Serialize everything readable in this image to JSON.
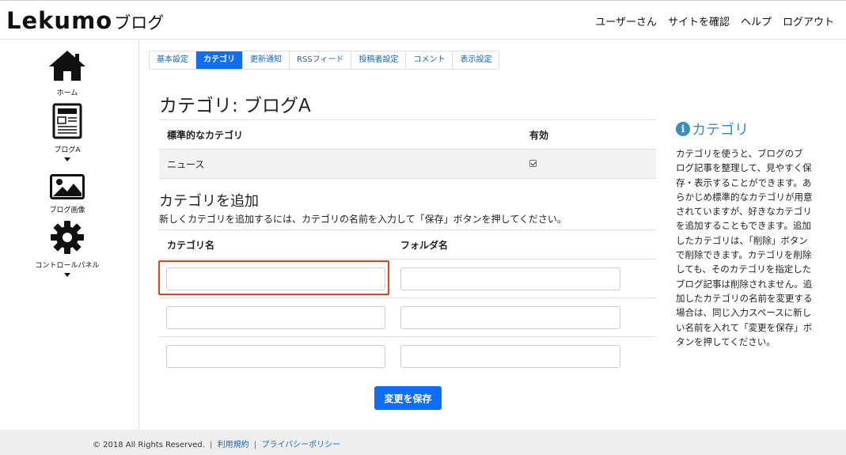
{
  "header": {
    "logo_main": "Lekumo",
    "logo_sub": "ブログ",
    "nav": [
      "ユーザーさん",
      "サイトを確認",
      "ヘルプ",
      "ログアウト"
    ]
  },
  "sidebar": {
    "items": [
      {
        "label": "ホーム",
        "icon": "home-icon"
      },
      {
        "label": "ブログA",
        "icon": "blog-icon"
      },
      {
        "label": "ブログ画像",
        "icon": "image-icon"
      },
      {
        "label": "コントロールパネル",
        "icon": "gear-icon"
      }
    ]
  },
  "tabs": [
    "基本設定",
    "カテゴリ",
    "更新通知",
    "RSSフィード",
    "投稿者設定",
    "コメント",
    "表示設定"
  ],
  "active_tab": "カテゴリ",
  "page_title": "カテゴリ: ブログA",
  "standard_table": {
    "col_name": "標準的なカテゴリ",
    "col_enabled": "有効",
    "rows": [
      {
        "name": "ニュース",
        "enabled": true
      }
    ]
  },
  "add_section": {
    "title": "カテゴリを追加",
    "description": "新しくカテゴリを追加するには、カテゴリの名前を入力して「保存」ボタンを押してください。",
    "col_name": "カテゴリ名",
    "col_folder": "フォルダ名",
    "rows": [
      {
        "name": "",
        "folder": ""
      },
      {
        "name": "",
        "folder": ""
      },
      {
        "name": "",
        "folder": ""
      }
    ]
  },
  "save_button": "変更を保存",
  "help": {
    "title": "カテゴリ",
    "icon": "info-icon",
    "lines": [
      "カテゴリを使うと、ブログのブ",
      "ログ記事を整理して、見やすく保",
      "存・表示することができます。あ",
      "らかじめ標準的なカテゴリが用意",
      "されていますが、好きなカテゴリ",
      "を追加することもできます。追加",
      "したカテゴリは、「削除」ボタン",
      "で削除できます。カテゴリを削除",
      "しても、そのカテゴリを指定した",
      "ブログ記事は削除されません。追",
      "加したカテゴリの名前を変更する",
      "場合は、同じ入力スペースに新し",
      "い名前を入れて「変更を保存」ボ",
      "タンを押してください。"
    ]
  },
  "footer": {
    "copyright": "© 2018 All Rights Reserved.",
    "terms": "利用規約",
    "privacy": "プライバシーポリシー"
  },
  "colors": {
    "accent": "#0d6efd",
    "help_title": "#3a8ec0",
    "highlight": "#e8401c"
  }
}
